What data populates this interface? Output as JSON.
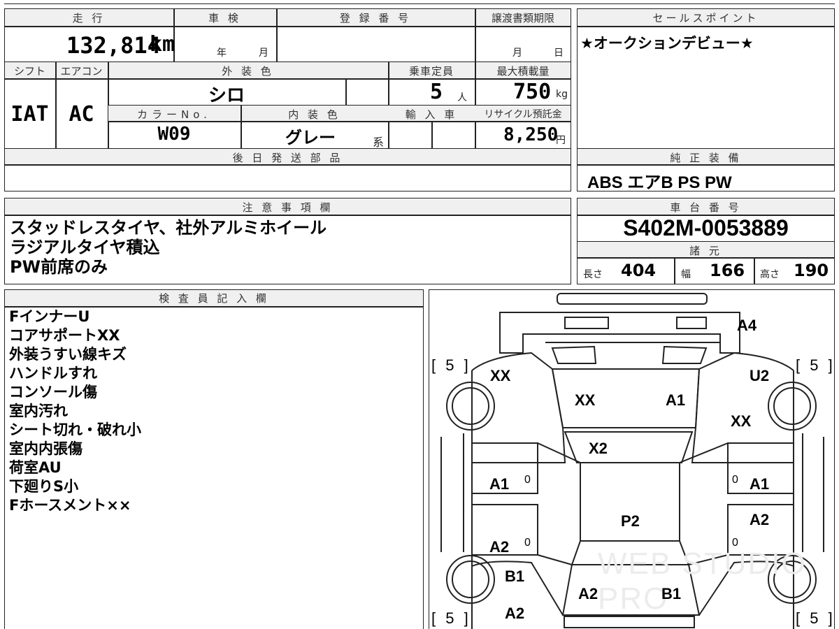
{
  "headers": {
    "mileage": "走 行",
    "inspection": "車 検",
    "registration": "登 録 番 号",
    "transfer_deadline": "譲渡書類期限",
    "sales_point": "セールスポイント",
    "shift": "シフト",
    "aircon": "エアコン",
    "exterior_color": "外 装 色",
    "capacity": "乗車定員",
    "max_load": "最大積載量",
    "color_no": "カラーNo.",
    "interior_color": "内 装 色",
    "import": "輸 入 車",
    "recycle": "リサイクル預託金",
    "later_parts": "後 日 発 送 部 品",
    "genuine_equipment": "純 正 装 備",
    "notes": "注 意 事 項 欄",
    "chassis_no": "車 台 番 号",
    "specs": "諸 元",
    "inspector": "検 査 員 記 入 欄"
  },
  "mileage": {
    "value": "132,814",
    "unit": "km"
  },
  "inspection": {
    "year_unit": "年",
    "month_unit": "月"
  },
  "transfer": {
    "month_unit": "月",
    "day_unit": "日"
  },
  "sales_point": "★オークションデビュー★",
  "shift": "IAT",
  "aircon": "AC",
  "exterior_color": "シロ",
  "capacity": {
    "value": "5",
    "unit": "人"
  },
  "max_load": {
    "value": "750",
    "unit": "kg"
  },
  "color_no": "W09",
  "interior_color": {
    "value": "グレー",
    "suffix": "系"
  },
  "recycle": {
    "value": "8,250",
    "unit": "円"
  },
  "genuine_equipment": "ABS エアB PS PW",
  "notes": [
    "スタッドレスタイヤ、社外アルミホイール",
    "ラジアルタイヤ積込",
    "PW前席のみ"
  ],
  "chassis_no": "S402M-0053889",
  "specs": {
    "length_label": "長さ",
    "length": "404",
    "width_label": "幅",
    "width": "166",
    "height_label": "高さ",
    "height": "190"
  },
  "inspector_notes": [
    "FインナーU",
    "コアサポートXX",
    "外装うすい線キズ",
    "ハンドルすれ",
    "コンソール傷",
    "室内汚れ",
    "シート切れ・破れ小",
    "室内内張傷",
    "荷室AU",
    "下廻りS小",
    "Fホースメント××"
  ],
  "diagram": {
    "marks": {
      "a4": "A4",
      "xx_left": "XX",
      "u2": "U2",
      "xx_hood": "XX",
      "a1_hood": "A1",
      "xx_right": "XX",
      "x2": "X2",
      "a1_left": "A1",
      "a1_right": "A1",
      "p2": "P2",
      "a2_right": "A2",
      "a2_left": "A2",
      "b1_left": "B1",
      "a2_bottom_left": "A2",
      "a2_rear": "A2",
      "b1_rear": "B1"
    },
    "zeros": [
      "0",
      "0",
      "0",
      "0"
    ],
    "tire_brackets": [
      "[ 5 ]",
      "[ 5 ]",
      "[ 5 ]",
      "[ 5 ]"
    ],
    "watermark": "WEB STUDIO PRO"
  }
}
